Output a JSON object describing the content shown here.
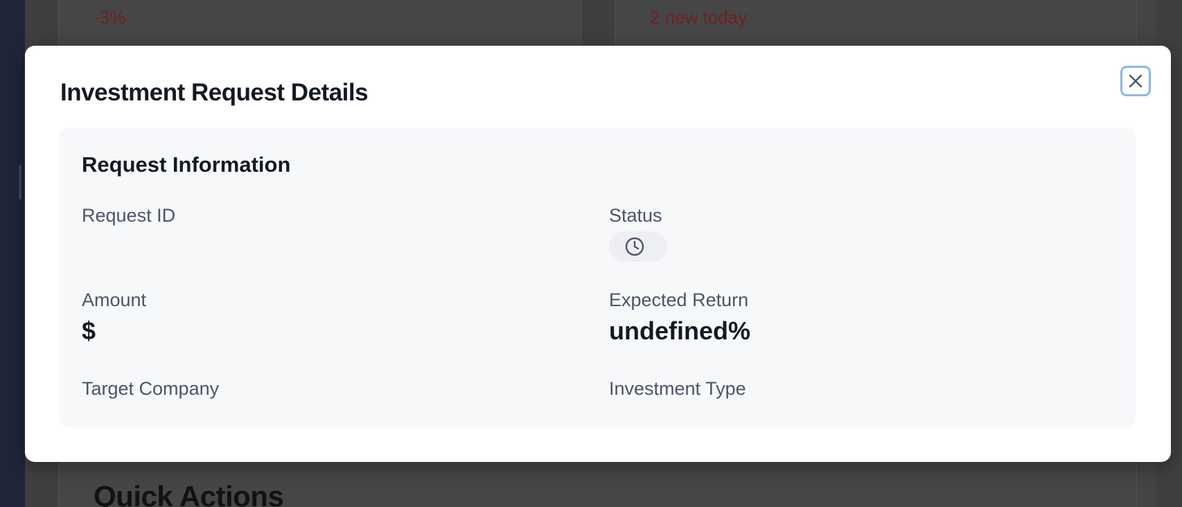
{
  "background": {
    "cards": [
      {
        "stat": "-3%"
      },
      {
        "stat": "2 new today"
      }
    ],
    "quick_actions_title": "Quick Actions"
  },
  "modal": {
    "title": "Investment Request Details",
    "close_icon": "close-icon",
    "panel": {
      "title": "Request Information",
      "fields": {
        "request_id": {
          "label": "Request ID",
          "value": ""
        },
        "status": {
          "label": "Status",
          "icon": "clock-icon",
          "value": ""
        },
        "amount": {
          "label": "Amount",
          "value": "$"
        },
        "expected_return": {
          "label": "Expected Return",
          "value": "undefined%"
        },
        "target_company": {
          "label": "Target Company",
          "value": ""
        },
        "investment_type": {
          "label": "Investment Type",
          "value": ""
        }
      }
    }
  },
  "colors": {
    "overlay_page": "#3f3f40",
    "stat_text": "#6e2222",
    "close_focus_ring": "#8db6ea",
    "panel_bg": "#f7f8fa"
  }
}
